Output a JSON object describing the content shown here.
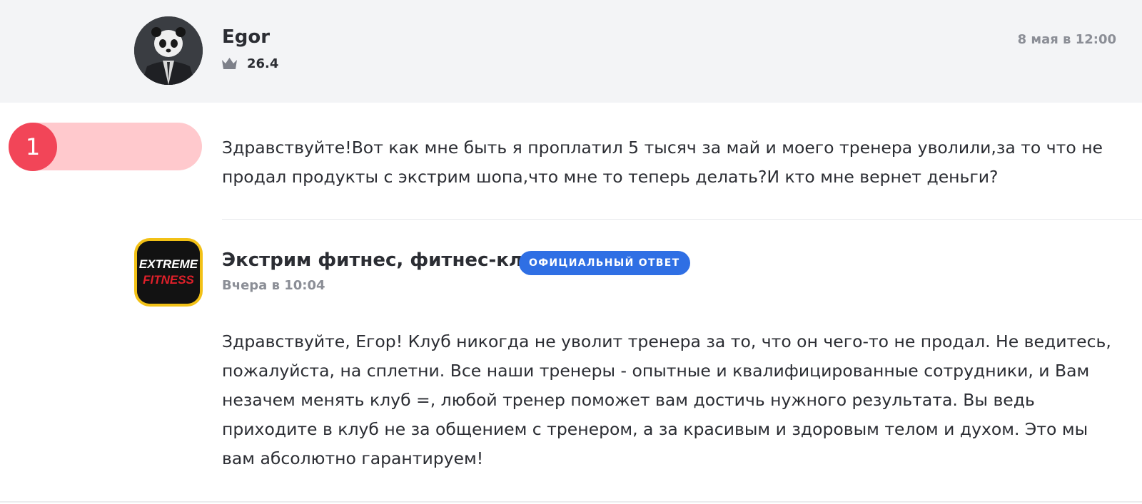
{
  "review": {
    "author": "Egor",
    "rating": "26.4",
    "date": "8 мая в 12:00",
    "number": "1",
    "text": "Здравствуйте!Вот как мне быть я проплатил 5 тысяч за май и моего тренера уволили,за то что не продал продукты с экстрим шопа,что мне то теперь делать?И кто мне вернет деньги?",
    "icons": {
      "avatar": "panda-avatar-icon",
      "rating": "crown-icon"
    }
  },
  "answer": {
    "company": "Экстрим фитнес, фитнес-клуб",
    "badge": "ОФИЦИАЛЬНЫЙ ОТВЕТ",
    "date": "Вчера в 10:04",
    "logo_text_1": "EXTREME",
    "logo_text_2": "FITNESS",
    "text": "Здравствуйте, Егор! Клуб никогда не уволит тренера за то, что он чего-то не продал. Не ведитесь, пожалуйста, на сплетни. Все наши тренеры - опытные и квалифицированные сотрудники, и Вам незачем менять клуб =, любой тренер поможет вам достичь нужного результата. Вы ведь приходите в клуб не за общением с тренером, а за красивым и здоровым телом и духом. Это мы вам абсолютно гарантируем!"
  },
  "colors": {
    "header_bg": "#f3f4f6",
    "badge_red": "#f24558",
    "pill_pink": "#ffc9cd",
    "official_blue": "#2f6fe4",
    "muted_text": "#8b8e96"
  }
}
